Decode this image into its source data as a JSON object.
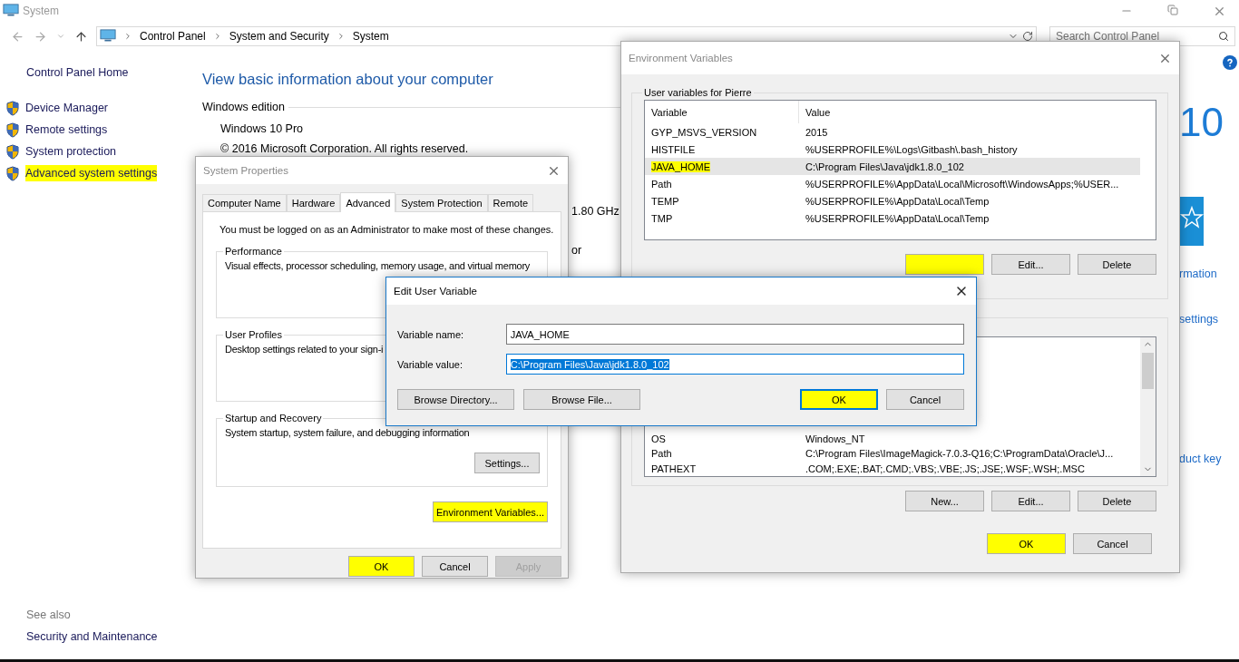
{
  "window": {
    "title": "System"
  },
  "address_bar": {
    "breadcrumb": [
      "Control Panel",
      "System and Security",
      "System"
    ],
    "search_placeholder": "Search Control Panel"
  },
  "sidebar": {
    "home": "Control Panel Home",
    "items": [
      {
        "label": "Device Manager",
        "highlighted": false
      },
      {
        "label": "Remote settings",
        "highlighted": false
      },
      {
        "label": "System protection",
        "highlighted": false
      },
      {
        "label": "Advanced system settings",
        "highlighted": true
      }
    ],
    "see_also": "See also",
    "see_also_items": [
      "Security and Maintenance"
    ]
  },
  "main": {
    "heading": "View basic information about your computer",
    "section": "Windows edition",
    "edition": "Windows 10 Pro",
    "copyright": "© 2016 Microsoft Corporation. All rights reserved.",
    "middle_fragments": [
      "1.80 GHz",
      "or"
    ],
    "logo_fragment": "10",
    "right_fragments": [
      "rmation",
      "settings",
      "duct key"
    ]
  },
  "system_properties": {
    "title": "System Properties",
    "tabs": [
      {
        "label": "Computer Name",
        "selected": false
      },
      {
        "label": "Hardware",
        "selected": false
      },
      {
        "label": "Advanced",
        "selected": true
      },
      {
        "label": "System Protection",
        "selected": false
      },
      {
        "label": "Remote",
        "selected": false
      }
    ],
    "notice": "You must be logged on as an Administrator to make most of these changes.",
    "groups": [
      {
        "title": "Performance",
        "text": "Visual effects, processor scheduling, memory usage, and virtual memory"
      },
      {
        "title": "User Profiles",
        "text": "Desktop settings related to your sign-i"
      },
      {
        "title": "Startup and Recovery",
        "text": "System startup, system failure, and debugging information",
        "button": "Settings..."
      }
    ],
    "env_button": {
      "label": "Environment Variables...",
      "highlighted": true
    },
    "buttons": [
      {
        "label": "OK",
        "highlighted": true,
        "disabled": false
      },
      {
        "label": "Cancel",
        "highlighted": false,
        "disabled": false
      },
      {
        "label": "Apply",
        "highlighted": false,
        "disabled": true
      }
    ]
  },
  "environment_variables": {
    "title": "Environment Variables",
    "user_group": "User variables for Pierre",
    "columns": [
      "Variable",
      "Value"
    ],
    "user_rows": [
      {
        "name": "GYP_MSVS_VERSION",
        "value": "2015",
        "selected": false,
        "highlighted": false
      },
      {
        "name": "HISTFILE",
        "value": "%USERPROFILE%\\Logs\\Gitbash\\.bash_history",
        "selected": false,
        "highlighted": false
      },
      {
        "name": "JAVA_HOME",
        "value": "C:\\Program Files\\Java\\jdk1.8.0_102",
        "selected": true,
        "highlighted": true
      },
      {
        "name": "Path",
        "value": "%USERPROFILE%\\AppData\\Local\\Microsoft\\WindowsApps;%USER...",
        "selected": false,
        "highlighted": false
      },
      {
        "name": "TEMP",
        "value": "%USERPROFILE%\\AppData\\Local\\Temp",
        "selected": false,
        "highlighted": false
      },
      {
        "name": "TMP",
        "value": "%USERPROFILE%\\AppData\\Local\\Temp",
        "selected": false,
        "highlighted": false
      }
    ],
    "user_buttons": [
      {
        "label": "Edit...",
        "highlighted": false
      },
      {
        "label": "Delete",
        "highlighted": false
      }
    ],
    "system_rows": [
      {
        "name": "OS",
        "value": "Windows_NT"
      },
      {
        "name": "Path",
        "value": "C:\\Program Files\\ImageMagick-7.0.3-Q16;C:\\ProgramData\\Oracle\\J..."
      },
      {
        "name": "PATHEXT",
        "value": ".COM;.EXE;.BAT;.CMD;.VBS;.VBE;.JS;.JSE;.WSF;.WSH;.MSC"
      }
    ],
    "system_buttons": [
      {
        "label": "New...",
        "highlighted": false
      },
      {
        "label": "Edit...",
        "highlighted": false
      },
      {
        "label": "Delete",
        "highlighted": false
      }
    ],
    "buttons": [
      {
        "label": "OK",
        "highlighted": true
      },
      {
        "label": "Cancel",
        "highlighted": false
      }
    ]
  },
  "edit_dialog": {
    "title": "Edit User Variable",
    "name_label": "Variable name:",
    "name_value": "JAVA_HOME",
    "value_label": "Variable value:",
    "value_value": "C:\\Program Files\\Java\\jdk1.8.0_102",
    "value_selected": true,
    "left_buttons": [
      "Browse Directory...",
      "Browse File..."
    ],
    "buttons": [
      {
        "label": "OK",
        "highlighted": true,
        "default": true
      },
      {
        "label": "Cancel",
        "highlighted": false,
        "default": false
      }
    ]
  }
}
